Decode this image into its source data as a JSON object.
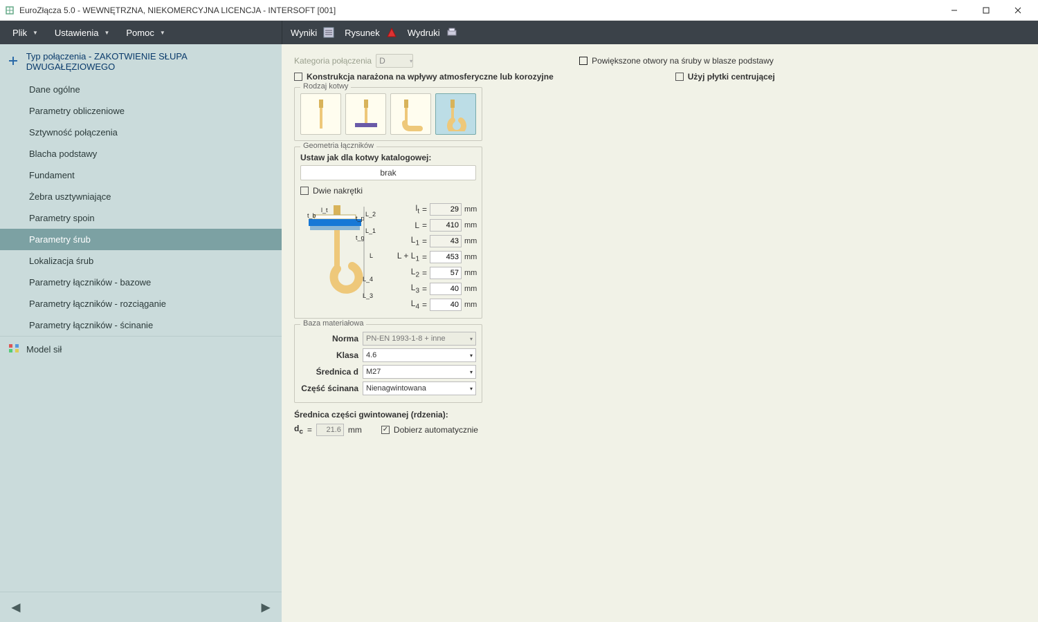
{
  "window": {
    "title": "EuroZłącza 5.0 - WEWNĘTRZNA, NIEKOMERCYJNA LICENCJA - INTERSOFT [001]"
  },
  "menubar": {
    "left": [
      "Plik",
      "Ustawienia",
      "Pomoc"
    ],
    "right": [
      "Wyniki",
      "Rysunek",
      "Wydruki"
    ]
  },
  "sidebar": {
    "header": "Typ połączenia - ZAKOTWIENIE SŁUPA DWUGAŁĘZIOWEGO",
    "items": [
      "Dane ogólne",
      "Parametry obliczeniowe",
      "Sztywność połączenia",
      "Blacha podstawy",
      "Fundament",
      "Żebra usztywniające",
      "Parametry spoin",
      "Parametry śrub",
      "Lokalizacja śrub",
      "Parametry łączników - bazowe",
      "Parametry łączników - rozciąganie",
      "Parametry łączników - ścinanie"
    ],
    "selected_index": 7,
    "model": "Model sił"
  },
  "main": {
    "category_label": "Kategoria połączenia",
    "category_value": "D",
    "chk_enlarged": "Powiększone otwory na śruby w blasze podstawy",
    "chk_atmos": "Konstrukcja narażona na wpływy atmosferyczne lub korozyjne",
    "chk_centering": "Użyj płytki centrującej",
    "anchor_legend": "Rodzaj kotwy",
    "geom_legend": "Geometria łączników",
    "geom_title": "Ustaw jak dla kotwy katalogowej:",
    "geom_button": "brak",
    "chk_twonuts": "Dwie nakrętki",
    "dims": [
      {
        "sym": "l_t",
        "eq": "=",
        "val": "29",
        "unit": "mm",
        "enabled": false
      },
      {
        "sym": "L",
        "eq": "=",
        "val": "410",
        "unit": "mm",
        "enabled": false
      },
      {
        "sym": "L_1",
        "eq": "=",
        "val": "43",
        "unit": "mm",
        "enabled": false
      },
      {
        "sym": "L + L_1",
        "eq": "=",
        "val": "453",
        "unit": "mm",
        "enabled": true
      },
      {
        "sym": "L_2",
        "eq": "=",
        "val": "57",
        "unit": "mm",
        "enabled": true
      },
      {
        "sym": "L_3",
        "eq": "=",
        "val": "40",
        "unit": "mm",
        "enabled": true
      },
      {
        "sym": "L_4",
        "eq": "=",
        "val": "40",
        "unit": "mm",
        "enabled": true
      }
    ],
    "mat_legend": "Baza materiałowa",
    "mat_rows": {
      "norma_label": "Norma",
      "norma_value": "PN-EN 1993-1-8 + inne",
      "klasa_label": "Klasa",
      "klasa_value": "4.6",
      "srednica_label": "Średnica d",
      "srednica_value": "M27",
      "czesc_label": "Część ścinana",
      "czesc_value": "Nienagwintowana"
    },
    "dc_title": "Średnica części gwintowanej (rdzenia):",
    "dc_sym_html": "d_c",
    "dc_eq": "=",
    "dc_val": "21.6",
    "dc_unit": "mm",
    "chk_auto": "Dobierz automatycznie",
    "chk_auto_checked": true
  }
}
